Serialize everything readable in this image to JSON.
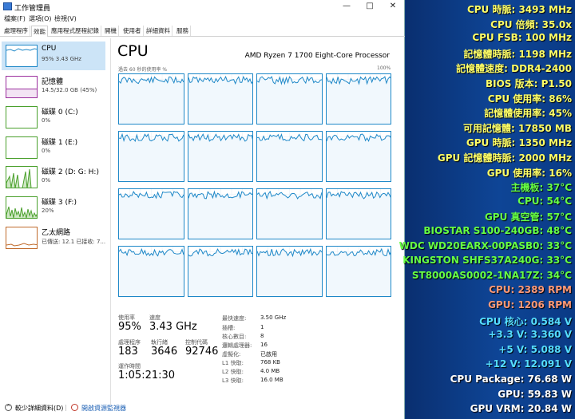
{
  "window": {
    "title": "工作管理員"
  },
  "menu": [
    "檔案(F)",
    "選項(O)",
    "檢視(V)"
  ],
  "tabs": [
    "處理程序",
    "效能",
    "應用程式歷程記錄",
    "開機",
    "使用者",
    "詳細資料",
    "服務"
  ],
  "sidebar": [
    {
      "name": "CPU",
      "value": "95% 3.43 GHz"
    },
    {
      "name": "記憶體",
      "value": "14.5/32.0 GB (45%)"
    },
    {
      "name": "磁碟 0 (C:)",
      "value": "0%"
    },
    {
      "name": "磁碟 1 (E:)",
      "value": "0%"
    },
    {
      "name": "磁碟 2 (D: G: H:)",
      "value": "0%"
    },
    {
      "name": "磁碟 3 (F:)",
      "value": "20%"
    },
    {
      "name": "乙太網路",
      "value": "已傳送: 12.1  已接收: 7..."
    }
  ],
  "main": {
    "title": "CPU",
    "model": "AMD Ryzen 7 1700 Eight-Core Processor",
    "chart_label_left": "過去 60 秒的使用率 %",
    "chart_label_right": "100%",
    "stats": {
      "usage_label": "使用率",
      "usage": "95%",
      "speed_label": "速度",
      "speed": "3.43 GHz",
      "processes_label": "處理程序",
      "processes": "183",
      "threads_label": "執行緒",
      "threads": "3646",
      "handles_label": "控制代碼",
      "handles": "92746",
      "uptime_label": "運作時間",
      "uptime": "1:05:21:30"
    },
    "specs": [
      {
        "key": "最快速度:",
        "value": "3.50 GHz"
      },
      {
        "key": "插槽:",
        "value": "1"
      },
      {
        "key": "核心數目:",
        "value": "8"
      },
      {
        "key": "邏輯處理器:",
        "value": "16"
      },
      {
        "key": "虛擬化:",
        "value": "已啟用"
      },
      {
        "key": "L1 快取:",
        "value": "768 KB"
      },
      {
        "key": "L2 快取:",
        "value": "4.0 MB"
      },
      {
        "key": "L3 快取:",
        "value": "16.0 MB"
      }
    ]
  },
  "status": {
    "less_details": "較少詳細資料(D)",
    "open_monitor": "開啟資源監視器"
  },
  "osd": [
    {
      "label": "CPU 時脈: 3493 MHz",
      "color": "#ffff66"
    },
    {
      "label": "CPU 倍頻: 35.0x",
      "color": "#ffff66"
    },
    {
      "label": "CPU FSB: 100 MHz",
      "color": "#ffff66"
    },
    {
      "label": "記憶體時脈: 1198 MHz",
      "color": "#ffff66"
    },
    {
      "label": "記憶體速度: DDR4-2400",
      "color": "#ffff66"
    },
    {
      "label": "BIOS 版本: P1.50",
      "color": "#ffff66"
    },
    {
      "label": "CPU 使用率: 86%",
      "color": "#ffff66"
    },
    {
      "label": "記憶體使用率: 45%",
      "color": "#ffff66"
    },
    {
      "label": "可用記憶體: 17850 MB",
      "color": "#ffff66"
    },
    {
      "label": "GPU 時脈: 1350 MHz",
      "color": "#ffff66"
    },
    {
      "label": "GPU 記憶體時脈: 2000 MHz",
      "color": "#ffff66"
    },
    {
      "label": "GPU 使用率: 16%",
      "color": "#ffff66"
    },
    {
      "label": "主機板: 37°C",
      "color": "#66ff44"
    },
    {
      "label": "CPU: 54°C",
      "color": "#66ff44"
    },
    {
      "label": "GPU 真空管: 57°C",
      "color": "#66ff44"
    },
    {
      "label": "BIOSTAR S100-240GB: 48°C",
      "color": "#66ff44"
    },
    {
      "label": "WDC WD20EARX-00PASB0: 33°C",
      "color": "#66ff44"
    },
    {
      "label": "KINGSTON SHFS37A240G: 33°C",
      "color": "#66ff44"
    },
    {
      "label": "ST8000AS0002-1NA17Z: 34°C",
      "color": "#66ff44"
    },
    {
      "label": "CPU: 2389 RPM",
      "color": "#ff9977"
    },
    {
      "label": "GPU: 1206 RPM",
      "color": "#ff9977"
    },
    {
      "label": "CPU 核心: 0.584 V",
      "color": "#55ddff"
    },
    {
      "label": "+3.3 V: 3.360 V",
      "color": "#55ddff"
    },
    {
      "label": "+5 V: 5.088 V",
      "color": "#55ddff"
    },
    {
      "label": "+12 V: 12.091 V",
      "color": "#55ddff"
    },
    {
      "label": "CPU Package: 76.68 W",
      "color": "#ffffff"
    },
    {
      "label": "GPU: 59.83 W",
      "color": "#ffffff"
    },
    {
      "label": "GPU VRM: 20.84 W",
      "color": "#ffffff"
    }
  ]
}
